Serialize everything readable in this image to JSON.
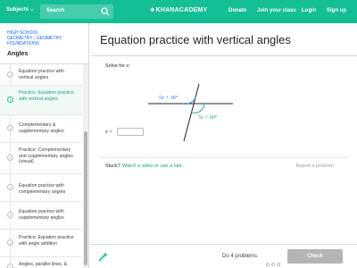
{
  "topbar": {
    "subjects_label": "Subjects",
    "search_placeholder": "Search",
    "logo_text": "KHANACADEMY",
    "nav": [
      "Donate",
      "Join your class",
      "Login",
      "Sign up"
    ],
    "brand_color": "#14bf96"
  },
  "sidebar": {
    "breadcrumb_line1": "HIGH SCHOOL",
    "breadcrumb_line2": "GEOMETRY",
    "breadcrumb_sep": "›",
    "breadcrumb_line3": "GEOMETRY FOUNDATIONS",
    "section_title": "Angles",
    "items": [
      {
        "label": "Equation practice with vertical angles",
        "active": false
      },
      {
        "label": "Practice: Equation practice with vertical angles",
        "active": true
      },
      {
        "label": "Complementary & supplementary angles",
        "active": false
      },
      {
        "label": "Practice: Complementary and supplementary angles (visual)",
        "active": false
      },
      {
        "label": "Equation practice with complementary angles",
        "active": false
      },
      {
        "label": "Equation practice with supplementary angles",
        "active": false
      },
      {
        "label": "Practice: Equation practice with angle addition",
        "active": false
      },
      {
        "label": "Angles, parallel lines, &",
        "active": false
      }
    ]
  },
  "exercise": {
    "title": "Equation practice with vertical angles",
    "prompt": "Solve for x:",
    "angle_top": "5x + 36°",
    "angle_bottom": "5x + 60°",
    "answer_label": "x =",
    "answer_value": "",
    "stuck_label": "Stuck?",
    "hint_link": "Watch a video or use a hint.",
    "report_link": "Report a problem"
  },
  "footer": {
    "progress_text": "Do 4 problems",
    "problems_total": 4,
    "problems_done": 0,
    "check_label": "Check"
  }
}
